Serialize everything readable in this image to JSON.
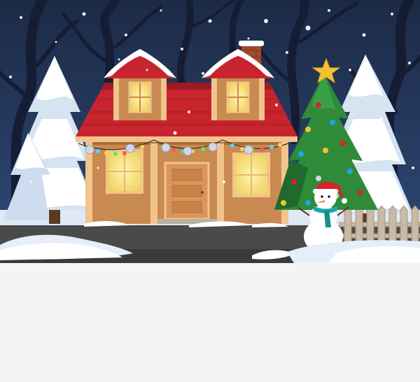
{
  "scene": {
    "subject": "christmas-house-night",
    "colors": {
      "sky_top": "#1f2d4a",
      "sky_bottom": "#2d4570",
      "tree_silhouette": "#162036",
      "roof": "#c8242e",
      "roof_dark": "#9c1b24",
      "wall": "#c98a52",
      "wall_trim": "#f1c48c",
      "window_glow": "#f5e27a",
      "door": "#d9955a",
      "snow": "#ffffff",
      "snow_shade": "#d8e4f2",
      "pine": "#2f8a3a",
      "pine_dark": "#1f6a2c",
      "star": "#f2c230",
      "road": "#4a4a4a",
      "fence": "#c9b9a6",
      "scarf": "#19a9a4",
      "santa_hat": "#d8232a",
      "panel_bg": "#f4f4f4"
    }
  }
}
